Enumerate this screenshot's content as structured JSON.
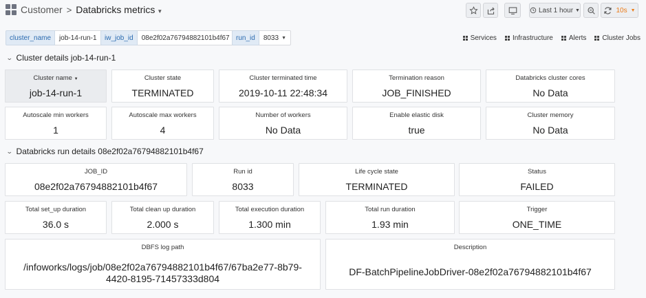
{
  "breadcrumb": {
    "parent": "Customer",
    "separator": ">",
    "title": "Databricks metrics"
  },
  "toolbar": {
    "time_range": "Last 1 hour",
    "refresh_interval": "10s"
  },
  "variables": [
    {
      "label": "cluster_name",
      "value": "job-14-run-1"
    },
    {
      "label": "iw_job_id",
      "value": "08e2f02a76794882101b4f67"
    },
    {
      "label": "run_id",
      "value": "8033"
    }
  ],
  "dashboard_links": [
    "Services",
    "Infrastructure",
    "Alerts",
    "Cluster Jobs"
  ],
  "rows": {
    "cluster": "Cluster details job-14-run-1",
    "run": "Databricks run details 08e2f02a76794882101b4f67"
  },
  "cluster_panels": [
    {
      "title": "Cluster name",
      "value": "job-14-run-1"
    },
    {
      "title": "Cluster state",
      "value": "TERMINATED"
    },
    {
      "title": "Cluster terminated time",
      "value": "2019-10-11 22:48:34"
    },
    {
      "title": "Termination reason",
      "value": "JOB_FINISHED"
    },
    {
      "title": "Databricks cluster cores",
      "value": "No Data"
    },
    {
      "title": "Autoscale min workers",
      "value": "1"
    },
    {
      "title": "Autoscale max workers",
      "value": "4"
    },
    {
      "title": "Number of workers",
      "value": "No Data"
    },
    {
      "title": "Enable elastic disk",
      "value": "true"
    },
    {
      "title": "Cluster memory",
      "value": "No Data"
    }
  ],
  "run_panels": [
    {
      "title": "JOB_ID",
      "value": "08e2f02a76794882101b4f67"
    },
    {
      "title": "Run id",
      "value": "8033"
    },
    {
      "title": "Life cycle state",
      "value": "TERMINATED"
    },
    {
      "title": "Status",
      "value": "FAILED"
    },
    {
      "title": "Total set_up duration",
      "value": "36.0 s"
    },
    {
      "title": "Total clean up duration",
      "value": "2.000 s"
    },
    {
      "title": "Total execution duration",
      "value": "1.300 min"
    },
    {
      "title": "Total run duration",
      "value": "1.93 min"
    },
    {
      "title": "Trigger",
      "value": "ONE_TIME"
    },
    {
      "title": "DBFS log path",
      "value": "/infoworks/logs/job/08e2f02a76794882101b4f67/67ba2e77-8b79-4420-8195-71457333d804"
    },
    {
      "title": "Description",
      "value": "DF-BatchPipelineJobDriver-08e2f02a76794882101b4f67"
    }
  ]
}
